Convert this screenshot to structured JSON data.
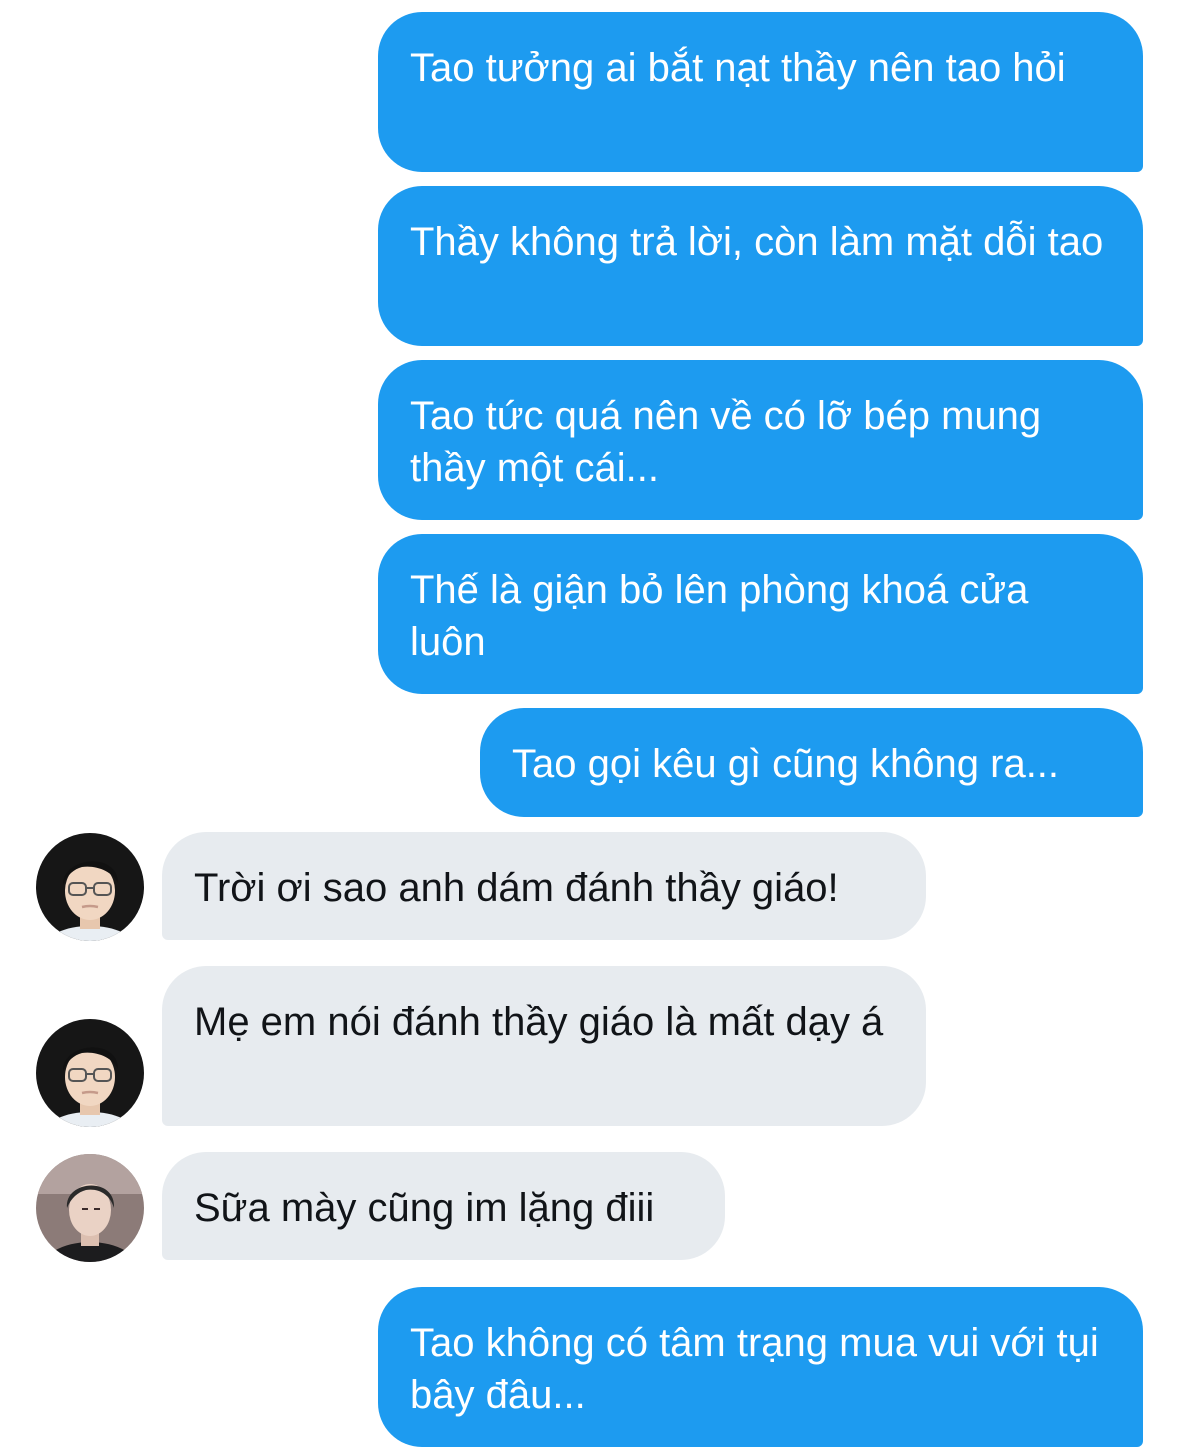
{
  "conversation": {
    "messages": [
      {
        "direction": "outgoing",
        "text": "Tao tưởng ai bắt nạt thầy nên tao hỏi"
      },
      {
        "direction": "outgoing",
        "text": "Thầy không trả lời, còn làm mặt dỗi tao"
      },
      {
        "direction": "outgoing",
        "text": "Tao tức quá nên về có lỡ bép mung thầy một cái..."
      },
      {
        "direction": "outgoing",
        "text": "Thế là giận bỏ lên phòng khoá cửa luôn"
      },
      {
        "direction": "outgoing",
        "text": "Tao gọi kêu gì cũng không ra..."
      },
      {
        "direction": "incoming",
        "text": "Trời ơi sao anh dám đánh thầy giáo!"
      },
      {
        "direction": "incoming",
        "text": "Mẹ em nói đánh thầy giáo là mất dạy á"
      },
      {
        "direction": "incoming",
        "text": "Sữa mày cũng im lặng điii"
      },
      {
        "direction": "outgoing",
        "text": "Tao không có tâm trạng mua vui với tụi bây đâu..."
      }
    ]
  },
  "colors": {
    "outgoing_bubble": "#1d9bf0",
    "incoming_bubble": "#e7ebef",
    "outgoing_text": "#ffffff",
    "incoming_text": "#111418"
  }
}
